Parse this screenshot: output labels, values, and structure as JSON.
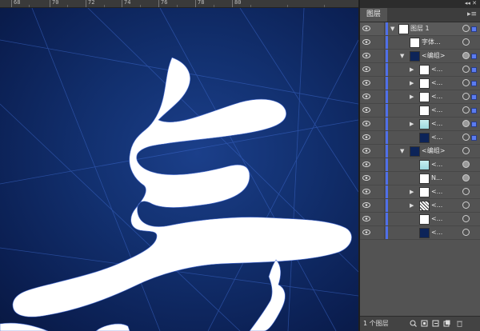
{
  "ruler": {
    "labels": [
      "68",
      "70",
      "72",
      "74",
      "76",
      "78",
      "80"
    ]
  },
  "panel": {
    "tab_label": "图层",
    "top_layer_label": "图层 1",
    "rows": [
      {
        "label": "字体..."
      },
      {
        "label": "<编组>"
      },
      {
        "label": "<..."
      },
      {
        "label": "<..."
      },
      {
        "label": "<..."
      },
      {
        "label": "<..."
      },
      {
        "label": "<..."
      },
      {
        "label": "<..."
      },
      {
        "label": "<编组>"
      },
      {
        "label": "<..."
      },
      {
        "label": "N..."
      },
      {
        "label": "<..."
      },
      {
        "label": "<..."
      },
      {
        "label": "<..."
      },
      {
        "label": "<..."
      }
    ],
    "footer_label": "1 个图层"
  },
  "colors": {
    "accent": "#4f6fe8",
    "canvas_bg": "#0b1f52"
  }
}
